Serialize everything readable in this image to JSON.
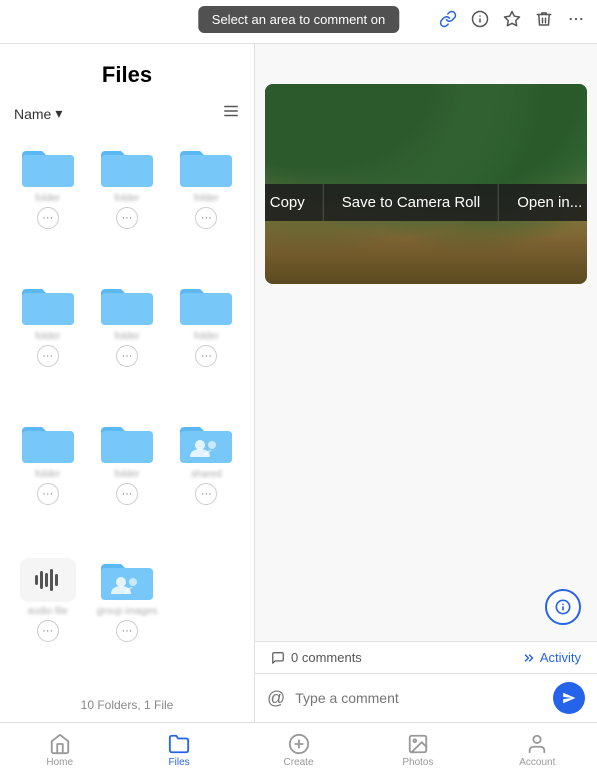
{
  "topBar": {
    "tooltip": "Select an area to comment on",
    "icons": [
      "link",
      "info-circle",
      "star",
      "trash",
      "more"
    ]
  },
  "filesPanel": {
    "title": "Files",
    "headerName": "Name",
    "items": [
      {
        "type": "folder",
        "name": "folder1",
        "shared": false
      },
      {
        "type": "folder",
        "name": "folder2",
        "shared": false
      },
      {
        "type": "folder",
        "name": "folder3",
        "shared": false
      },
      {
        "type": "folder",
        "name": "folder4",
        "shared": false
      },
      {
        "type": "folder",
        "name": "folder5",
        "shared": false
      },
      {
        "type": "folder",
        "name": "folder6",
        "shared": false
      },
      {
        "type": "folder",
        "name": "folder7",
        "shared": false
      },
      {
        "type": "folder",
        "name": "folder8",
        "shared": false
      },
      {
        "type": "shared-folder",
        "name": "shared1",
        "shared": true
      },
      {
        "type": "audio",
        "name": "audio file"
      },
      {
        "type": "shared-folder",
        "name": "group images",
        "shared": true
      }
    ],
    "summary": "10 Folders, 1 File"
  },
  "contextMenu": {
    "items": [
      "Copy",
      "Save to Camera Roll",
      "Open in..."
    ]
  },
  "commentBar": {
    "commentsCount": "0 comments",
    "activityLabel": "Activity"
  },
  "commentInput": {
    "placeholder": "Type a comment"
  },
  "bottomNav": {
    "items": [
      {
        "label": "Home",
        "icon": "home"
      },
      {
        "label": "Files",
        "icon": "files",
        "active": true
      },
      {
        "label": "Create",
        "icon": "plus"
      },
      {
        "label": "Photos",
        "icon": "photos"
      },
      {
        "label": "Account",
        "icon": "account"
      }
    ]
  }
}
